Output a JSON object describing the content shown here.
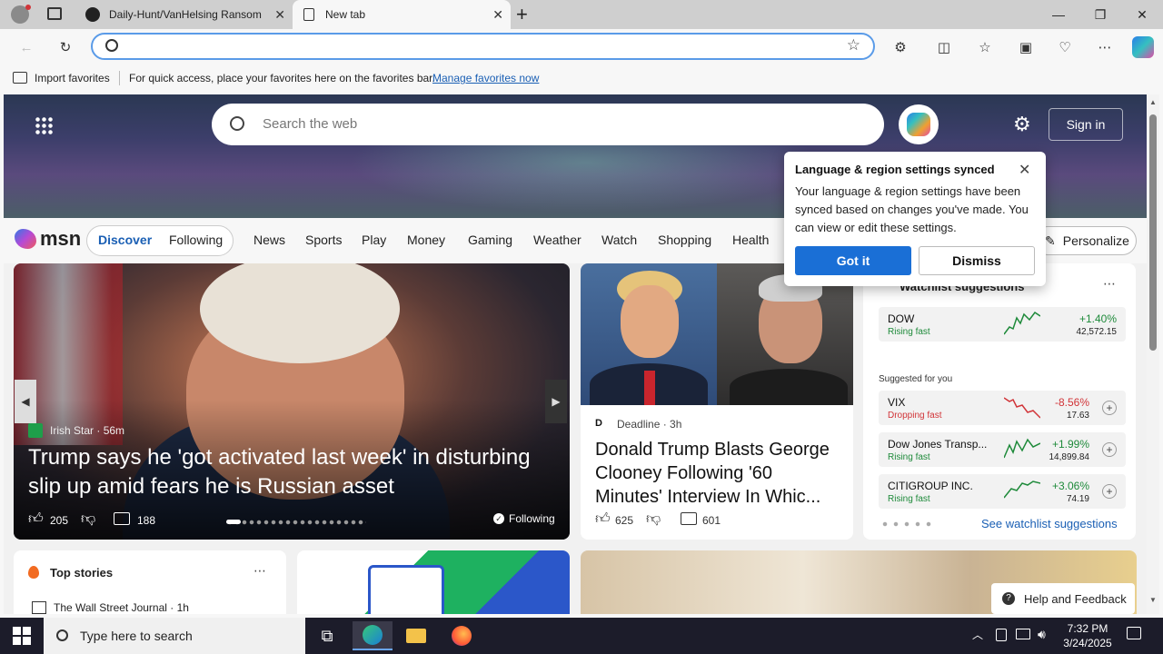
{
  "browser": {
    "tabs": [
      {
        "label": "Daily-Hunt/VanHelsing Ransom"
      },
      {
        "label": "New tab"
      }
    ],
    "address_placeholder": "",
    "favorites_bar": {
      "import_label": "Import favorites",
      "message": "For quick access, place your favorites here on the favorites bar.",
      "link": "Manage favorites now"
    }
  },
  "msn": {
    "search_placeholder": "Search the web",
    "sign_in": "Sign in",
    "logo": "msn",
    "nav_pills": [
      "Discover",
      "Following"
    ],
    "nav_items": [
      "News",
      "Sports",
      "Play",
      "Money",
      "Gaming",
      "Weather",
      "Watch",
      "Shopping",
      "Health"
    ],
    "personalize": "Personalize"
  },
  "popup": {
    "title": "Language & region settings synced",
    "text": "Your language & region settings have been synced based on changes you've made. You can view or edit these settings.",
    "got_it": "Got it",
    "dismiss": "Dismiss"
  },
  "hero_story": {
    "source": "Irish Star",
    "age": "56m",
    "headline": "Trump says he 'got activated last week' in disturbing slip up amid fears he is Russian asset",
    "likes": "205",
    "comments": "188",
    "following": "Following"
  },
  "second_story": {
    "source_initial": "D",
    "source": "Deadline",
    "age": "3h",
    "headline": "Donald Trump Blasts George Clooney Following '60 Minutes' Interview In Whic...",
    "likes": "625",
    "comments": "601"
  },
  "watchlist": {
    "title": "Watchlist suggestions",
    "suggested_label": "Suggested for you",
    "link": "See watchlist suggestions",
    "stocks": [
      {
        "name": "DOW",
        "status": "Rising fast",
        "change": "+1.40%",
        "value": "42,572.15",
        "color": "#1e8a3a"
      },
      {
        "name": "VIX",
        "status": "Dropping fast",
        "change": "-8.56%",
        "value": "17.63",
        "color": "#d13438"
      },
      {
        "name": "Dow Jones Transp...",
        "status": "Rising fast",
        "change": "+1.99%",
        "value": "14,899.84",
        "color": "#1e8a3a"
      },
      {
        "name": "CITIGROUP INC.",
        "status": "Rising fast",
        "change": "+3.06%",
        "value": "74.19",
        "color": "#1e8a3a"
      }
    ]
  },
  "top_stories": {
    "title": "Top stories",
    "first_source": "The Wall Street Journal",
    "first_age": "1h"
  },
  "feedback": "Help and Feedback",
  "taskbar": {
    "search_placeholder": "Type here to search",
    "time": "7:32 PM",
    "date": "3/24/2025"
  }
}
